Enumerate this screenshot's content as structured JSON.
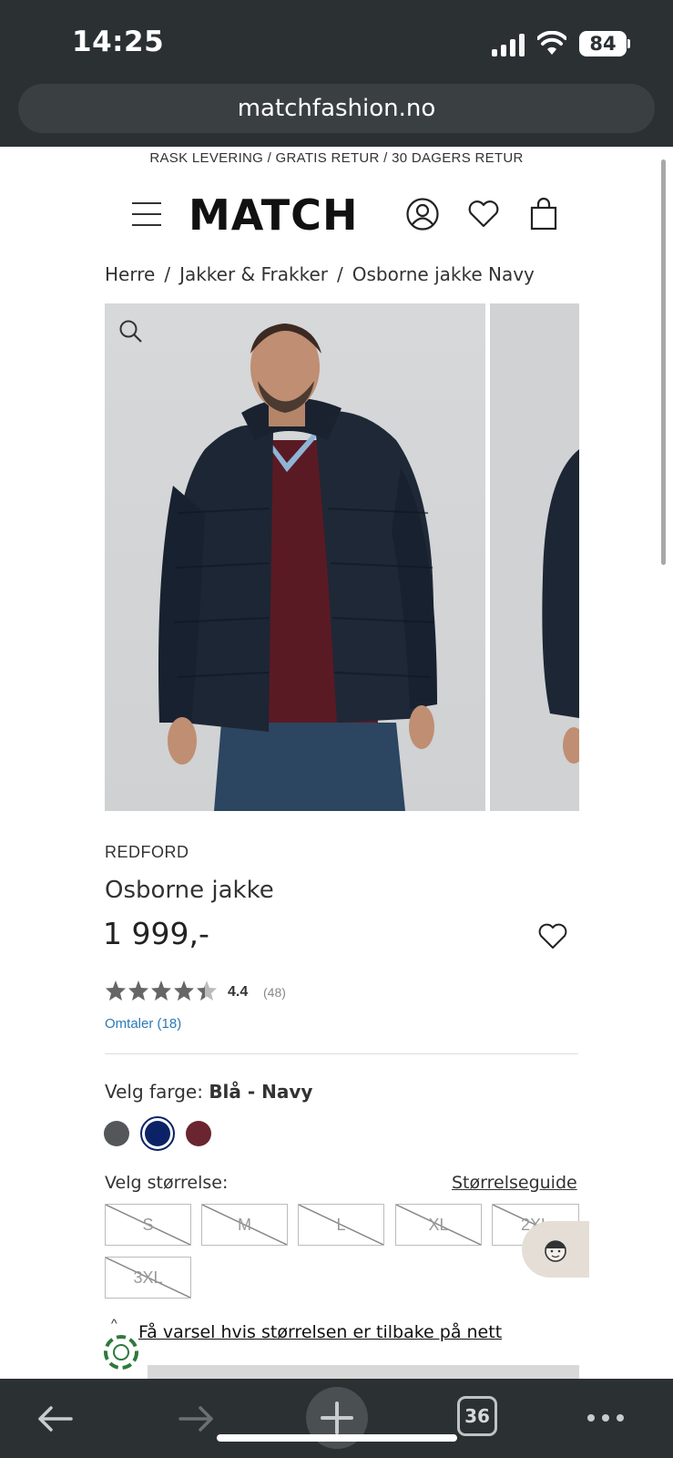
{
  "status": {
    "time": "14:25",
    "battery": "84"
  },
  "browser": {
    "url": "matchfashion.no",
    "tabs_count": "36"
  },
  "promo": "RASK LEVERING / GRATIS RETUR / 30 DAGERS RETUR",
  "header": {
    "logo": "MATCH",
    "icons": [
      "menu-icon",
      "account-icon",
      "heart-icon",
      "bag-icon"
    ]
  },
  "breadcrumb": [
    "Herre",
    "Jakker & Frakker",
    "Osborne jakke Navy"
  ],
  "product": {
    "brand": "REDFORD",
    "name": "Osborne jakke",
    "price": "1 999,-",
    "rating": "4.4",
    "rating_count": "(48)",
    "rating_value": 4.4,
    "reviews_link": "Omtaler (18)"
  },
  "color": {
    "label": "Velg farge:",
    "selected": "Blå - Navy",
    "swatches": [
      "#545759",
      "#0b2366",
      "#6a2530"
    ]
  },
  "size": {
    "label": "Velg størrelse:",
    "guide": "Størrelseguide",
    "options": [
      "S",
      "M",
      "L",
      "XL",
      "2XL",
      "3XL"
    ]
  },
  "notify_link": "Få varsel hvis størrelsen er tilbake på nett"
}
